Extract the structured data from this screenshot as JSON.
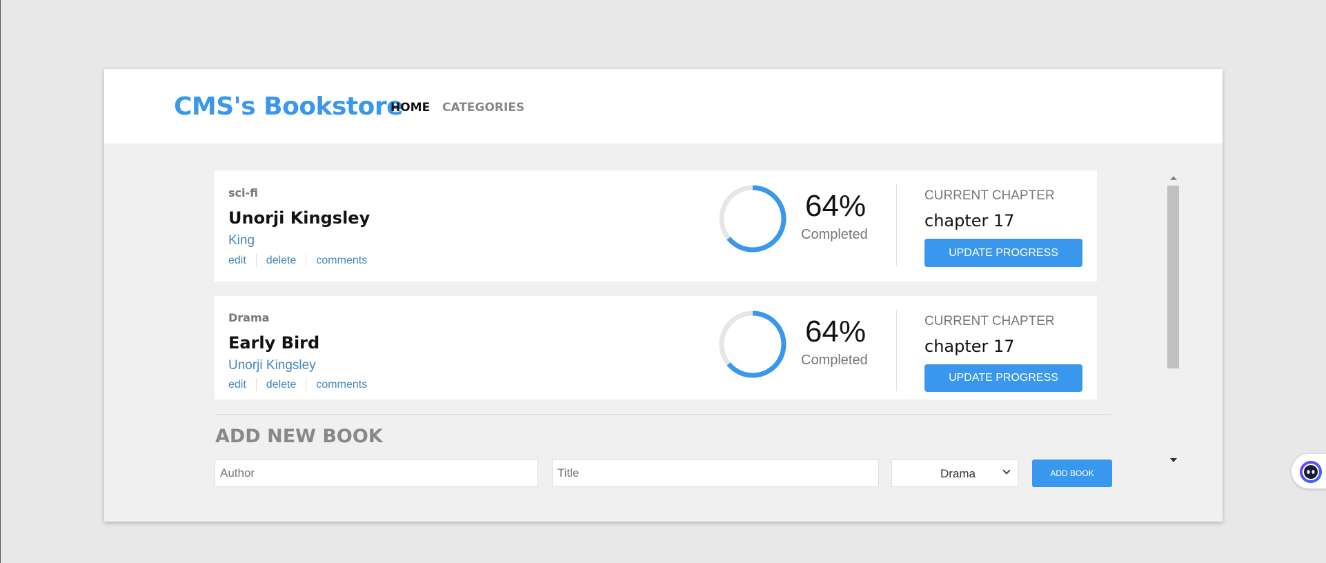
{
  "header": {
    "brand": "CMS's Bookstore",
    "nav": {
      "home": "HOME",
      "categories": "CATEGORIES"
    }
  },
  "books": [
    {
      "category": "sci-fi",
      "title": "Unorji Kingsley",
      "author": "King",
      "actions": {
        "edit": "edit",
        "delete": "delete",
        "comments": "comments"
      },
      "progress_percent": 64,
      "progress_text": "64%",
      "completed_label": "Completed",
      "current_chapter_label": "CURRENT CHAPTER",
      "current_chapter": "chapter 17",
      "update_button": "UPDATE PROGRESS"
    },
    {
      "category": "Drama",
      "title": "Early Bird",
      "author": "Unorji Kingsley",
      "actions": {
        "edit": "edit",
        "delete": "delete",
        "comments": "comments"
      },
      "progress_percent": 64,
      "progress_text": "64%",
      "completed_label": "Completed",
      "current_chapter_label": "CURRENT CHAPTER",
      "current_chapter": "chapter 17",
      "update_button": "UPDATE PROGRESS"
    }
  ],
  "add_book": {
    "title": "ADD NEW BOOK",
    "author_placeholder": "Author",
    "title_placeholder": "Title",
    "category_selected": "Drama",
    "button": "ADD BOOK"
  },
  "colors": {
    "accent": "#3a97ee",
    "link": "#4386bf",
    "ring_track": "#e6e6e6"
  },
  "icons": {
    "widget": "assistant-face-icon",
    "select": "chevron-down-icon"
  }
}
